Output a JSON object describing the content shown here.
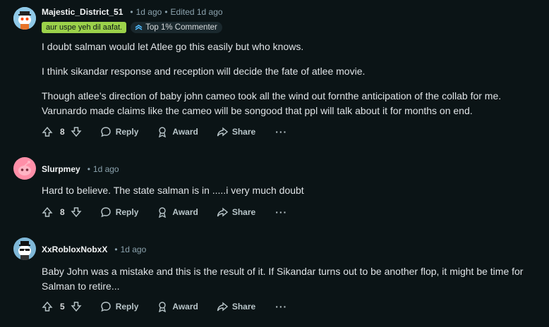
{
  "comments": [
    {
      "username": "Majestic_District_51",
      "time": "1d ago",
      "edited": "Edited 1d ago",
      "flair": "aur uspe yeh dil aafat.",
      "badge": "Top 1% Commenter",
      "paragraphs": [
        "I doubt salman would let Atlee go this easily but who knows.",
        "I think sikandar response and reception will decide the fate of atlee movie.",
        "Though atlee’s direction of baby john cameo took all the wind out fornthe anticipation of the collab for me. Varunardo made claims like the cameo will be songood that ppl will talk about it for months on end."
      ],
      "votes": "8"
    },
    {
      "username": "Slurpmey",
      "time": "1d ago",
      "paragraphs": [
        "Hard to believe. The state salman is in .....i very much doubt"
      ],
      "votes": "8"
    },
    {
      "username": "XxRobloxNobxX",
      "time": "1d ago",
      "paragraphs": [
        "Baby John was a mistake and this is the result of it. If Sikandar turns out to be another flop, it might be time for Salman to retire..."
      ],
      "votes": "5"
    }
  ],
  "actions": {
    "reply": "Reply",
    "award": "Award",
    "share": "Share",
    "more": "···"
  },
  "colors": {
    "background": "#0b1416",
    "flair_green": "#9bd14a",
    "avatar_pink": "#ff6f8f"
  },
  "icons": [
    "upvote-icon",
    "downvote-icon",
    "reply-icon",
    "award-icon",
    "share-icon",
    "more-icon",
    "top-commenter-icon"
  ]
}
